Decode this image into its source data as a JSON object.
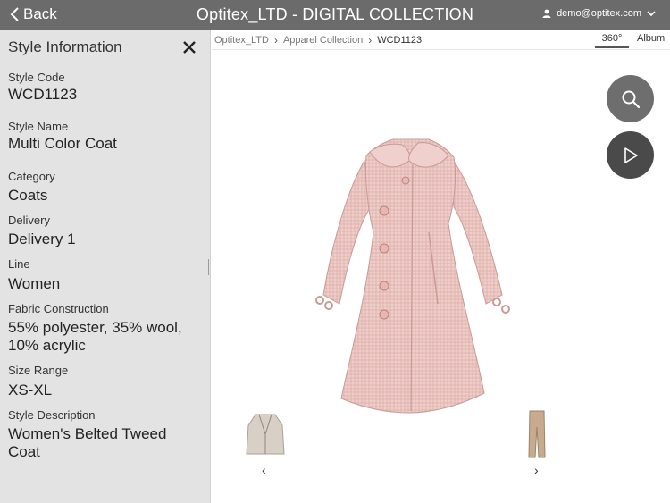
{
  "header": {
    "back_label": "Back",
    "title": "Optitex_LTD - DIGITAL COLLECTION",
    "user_email": "demo@optitex.com"
  },
  "sidebar": {
    "title": "Style Information",
    "fields": [
      {
        "label": "Style Code",
        "value": "WCD1123"
      },
      {
        "label": "Style Name",
        "value": "Multi Color Coat"
      },
      {
        "label": "Category",
        "value": "Coats"
      },
      {
        "label": "Delivery",
        "value": "Delivery 1"
      },
      {
        "label": "Line",
        "value": "Women"
      },
      {
        "label": "Fabric Construction",
        "value": "55% polyester, 35% wool, 10% acrylic"
      },
      {
        "label": "Size Range",
        "value": "XS-XL"
      },
      {
        "label": "Style Description",
        "value": "Women's Belted Tweed Coat"
      }
    ]
  },
  "breadcrumb": {
    "items": [
      "Optitex_LTD",
      "Apparel Collection",
      "WCD1123"
    ]
  },
  "view_tabs": {
    "selected": "360°",
    "items": [
      "360°",
      "Album"
    ]
  },
  "thumbnail_nav": {
    "prev": "‹",
    "next": "›"
  },
  "colors": {
    "header_bg": "#6b6b6b",
    "sidebar_bg": "#e3e3e3",
    "coat": "#e6bcb9",
    "zoom_button": "#6e6e6e",
    "play_button": "#4a4a4a"
  },
  "icons": [
    "chevron-left-icon",
    "user-icon",
    "chevron-down-icon",
    "close-icon",
    "search-icon",
    "play-icon"
  ]
}
